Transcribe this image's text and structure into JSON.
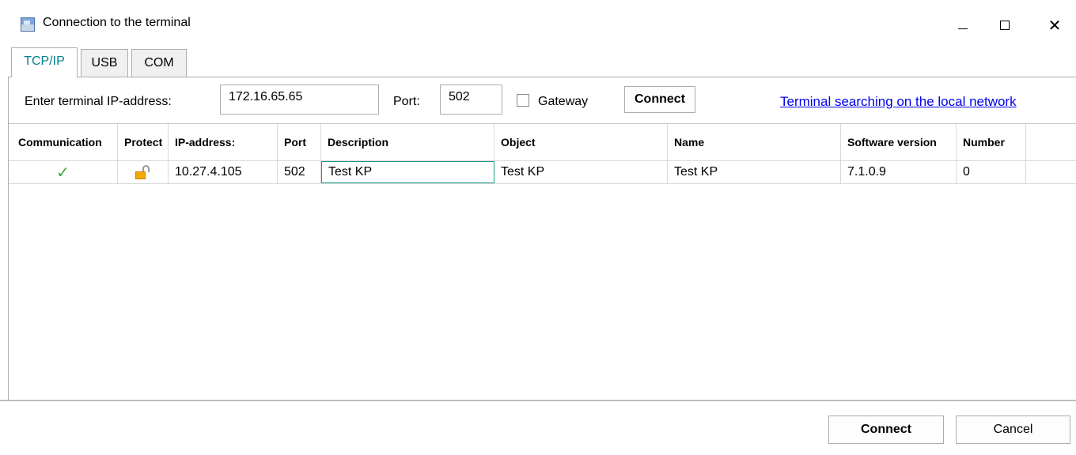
{
  "window": {
    "title": "Connection to the terminal"
  },
  "tabs": [
    {
      "label": "TCP/IP",
      "active": true
    },
    {
      "label": "USB",
      "active": false
    },
    {
      "label": "COM",
      "active": false
    }
  ],
  "toolbar": {
    "ip_label": "Enter terminal IP-address:",
    "ip_value": "172.16.65.65",
    "port_label": "Port:",
    "port_value": "502",
    "gateway_label": "Gateway",
    "gateway_checked": false,
    "connect_label": "Connect",
    "search_link": "Terminal searching on the local network"
  },
  "grid": {
    "columns": [
      "Communication",
      "Protect",
      "IP-address:",
      "Port",
      "Description",
      "Object",
      "Name",
      "Software version",
      "Number"
    ],
    "rows": [
      {
        "communication_icon": "checkmark-icon",
        "protect_icon": "unlocked-padlock-icon",
        "ip": "10.27.4.105",
        "port": "502",
        "description": "Test KP",
        "object": "Test KP",
        "name": "Test KP",
        "software_version": "7.1.0.9",
        "number": "0"
      }
    ]
  },
  "footer": {
    "connect_label": "Connect",
    "cancel_label": "Cancel"
  },
  "colors": {
    "active_tab_text": "#00808a",
    "link": "#0000ee",
    "check": "#3aa83a",
    "lock": "#f2a900",
    "focus_border": "#1a9b87"
  }
}
